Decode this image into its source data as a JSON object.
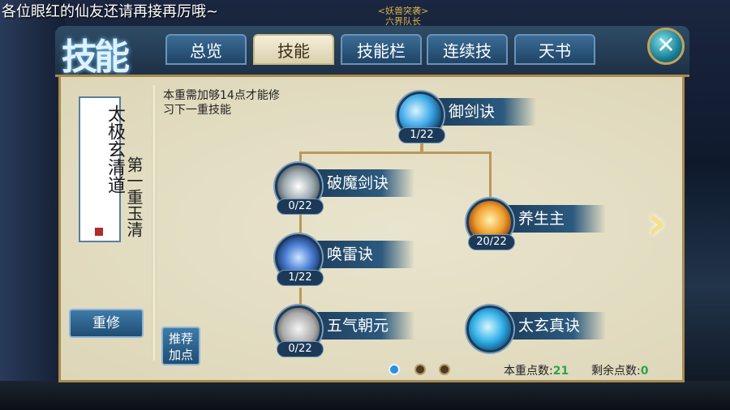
{
  "broadcast": {
    "text": "各位眼红的仙友还请再接再厉哦~"
  },
  "guild": {
    "line1": "<妖兽突袭>",
    "line2": "六界队长"
  },
  "panel": {
    "title": "技能",
    "tabs": [
      "总览",
      "技能",
      "技能栏",
      "连续技",
      "天书"
    ],
    "active_tab": 1,
    "close_icon": "close-icon"
  },
  "school": {
    "name": "太极玄清道",
    "tier": "第一重玉清"
  },
  "buttons": {
    "rebuild": "重修",
    "recommend_line1": "推荐",
    "recommend_line2": "加点"
  },
  "notice": "本重需加够14点才能修习下一重技能",
  "skills": [
    {
      "name": "御剑诀",
      "level": "1/22",
      "icon": "sword-icon"
    },
    {
      "name": "破魔剑诀",
      "level": "0/22",
      "icon": "break-demon-icon"
    },
    {
      "name": "养生主",
      "level": "20/22",
      "icon": "life-icon"
    },
    {
      "name": "唤雷诀",
      "level": "1/22",
      "icon": "thunder-icon"
    },
    {
      "name": "五气朝元",
      "level": "0/22",
      "icon": "qi-icon"
    },
    {
      "name": "太玄真诀",
      "level": "",
      "icon": "xuan-icon"
    }
  ],
  "pagination": {
    "pages": 3,
    "current": 1
  },
  "points": {
    "tier_label": "本重点数:",
    "tier_value": "21",
    "remaining_label": "剩余点数:",
    "remaining_value": "0"
  },
  "colors": {
    "accent": "#1c3a57",
    "gold": "#b99a5b",
    "panel_bg": "#ece7d1",
    "point_value": "#2fa34a"
  }
}
